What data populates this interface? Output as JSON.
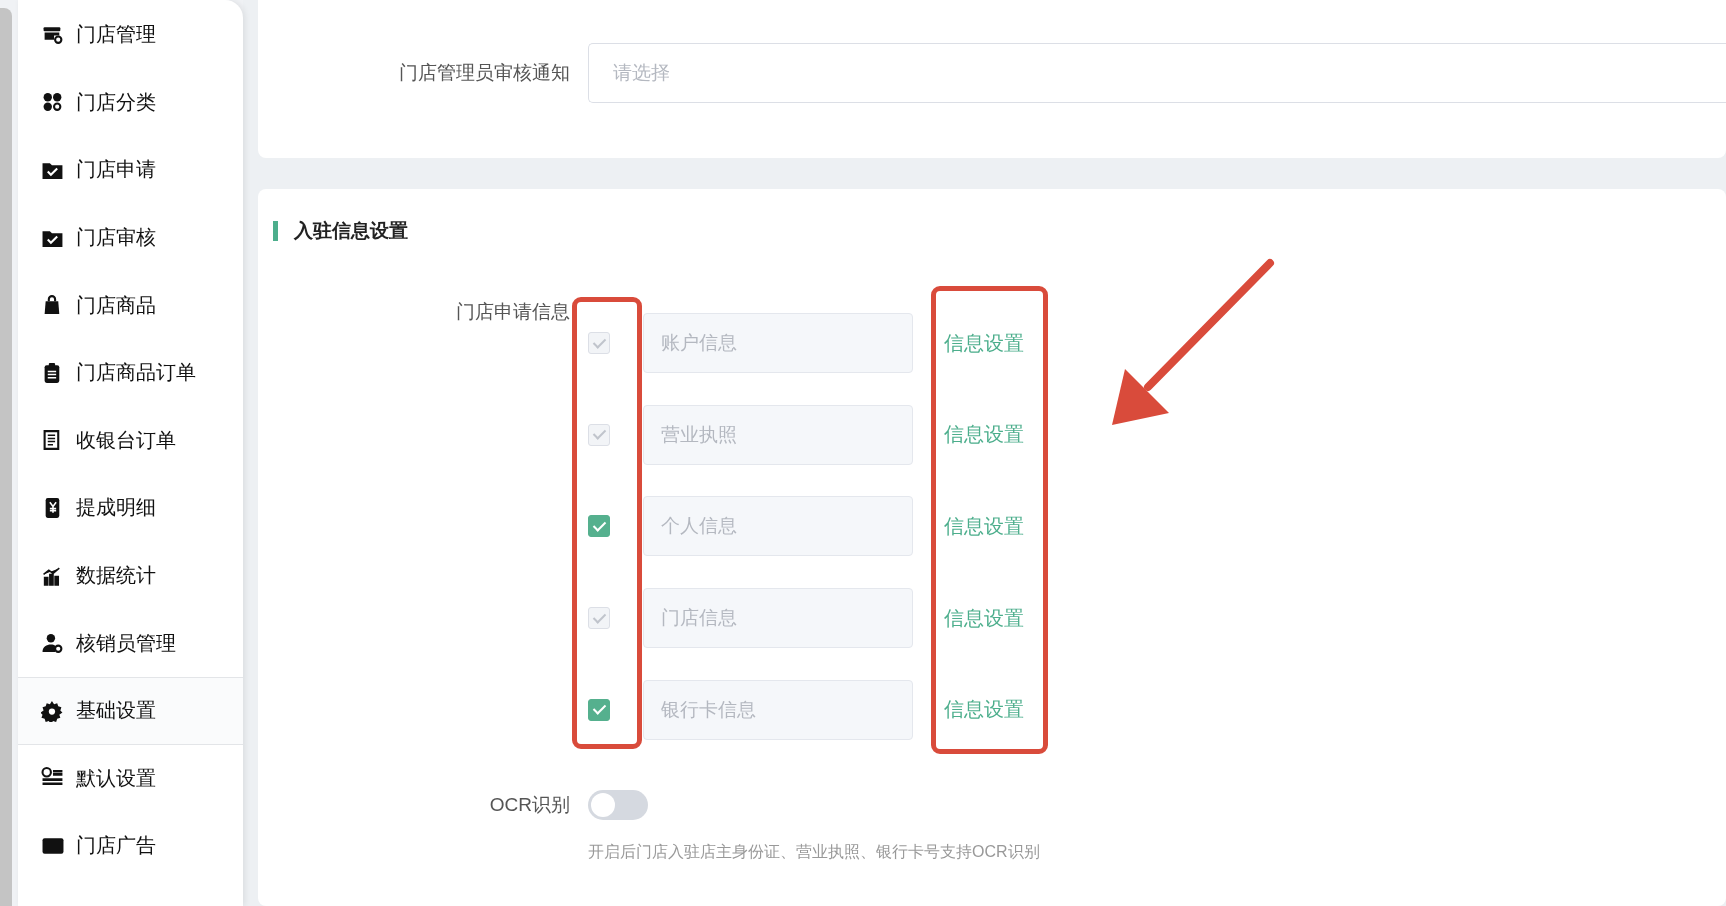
{
  "sidebar": {
    "items": [
      {
        "label": "门店管理",
        "selected": false
      },
      {
        "label": "门店分类",
        "selected": false
      },
      {
        "label": "门店申请",
        "selected": false
      },
      {
        "label": "门店审核",
        "selected": false
      },
      {
        "label": "门店商品",
        "selected": false
      },
      {
        "label": "门店商品订单",
        "selected": false
      },
      {
        "label": "收银台订单",
        "selected": false
      },
      {
        "label": "提成明细",
        "selected": false
      },
      {
        "label": "数据统计",
        "selected": false
      },
      {
        "label": "核销员管理",
        "selected": false
      },
      {
        "label": "基础设置",
        "selected": true
      },
      {
        "label": "默认设置",
        "selected": false
      },
      {
        "label": "门店广告",
        "selected": false
      }
    ]
  },
  "notice": {
    "label": "门店管理员审核通知",
    "placeholder": "请选择"
  },
  "entry_section": {
    "title": "入驻信息设置",
    "label": "门店申请信息",
    "fields": [
      {
        "checked": true,
        "disabled": true,
        "value": "账户信息",
        "link": "信息设置"
      },
      {
        "checked": true,
        "disabled": true,
        "value": "营业执照",
        "link": "信息设置"
      },
      {
        "checked": true,
        "disabled": false,
        "value": "个人信息",
        "link": "信息设置"
      },
      {
        "checked": true,
        "disabled": true,
        "value": "门店信息",
        "link": "信息设置"
      },
      {
        "checked": true,
        "disabled": false,
        "value": "银行卡信息",
        "link": "信息设置"
      }
    ],
    "ocr": {
      "label": "OCR识别",
      "on": false,
      "hint": "开启后门店入驻店主身份证、营业执照、银行卡号支持OCR识别"
    }
  }
}
